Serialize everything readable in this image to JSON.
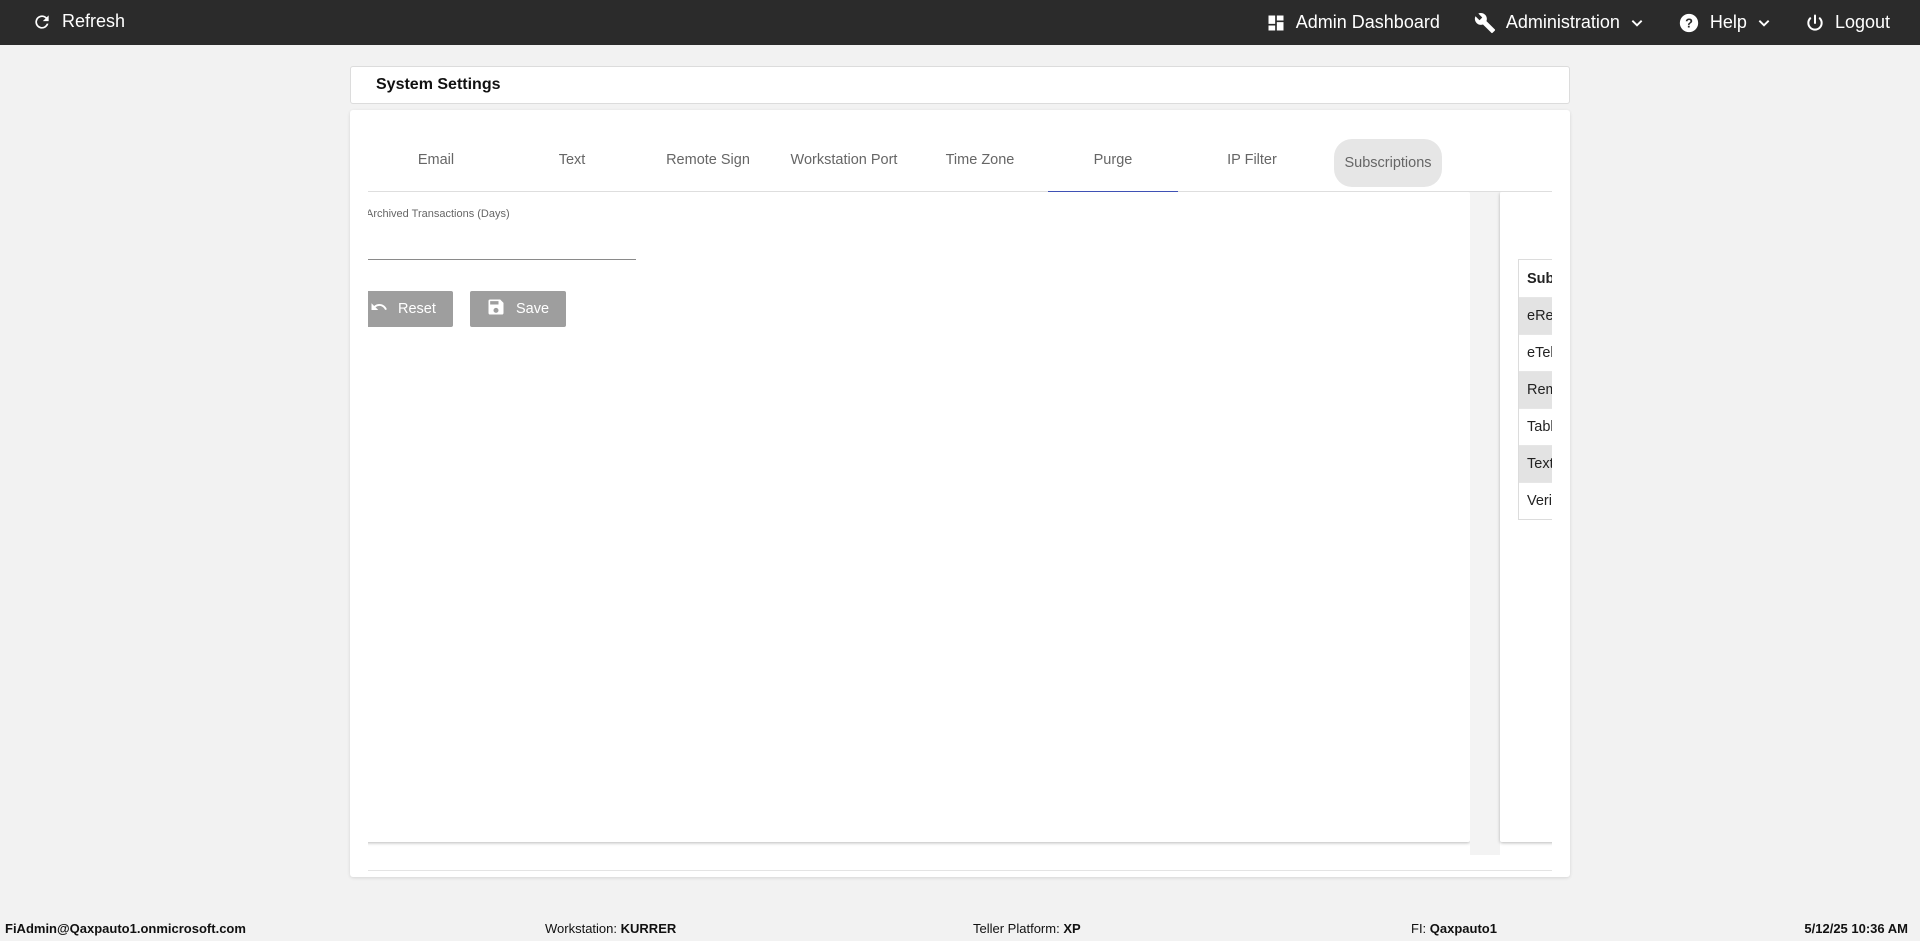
{
  "topbar": {
    "refresh_label": "Refresh",
    "admin_dashboard_label": "Admin Dashboard",
    "administration_label": "Administration",
    "help_label": "Help",
    "logout_label": "Logout"
  },
  "page": {
    "title": "System Settings"
  },
  "tabs": [
    {
      "label": "Email"
    },
    {
      "label": "Text"
    },
    {
      "label": "Remote Sign"
    },
    {
      "label": "Workstation Port"
    },
    {
      "label": "Time Zone"
    },
    {
      "label": "Purge"
    },
    {
      "label": "IP Filter"
    },
    {
      "label": "Subscriptions"
    }
  ],
  "active_tab": "Purge",
  "purge_panel": {
    "field_label": "Archived Transactions (Days)",
    "field_value": "",
    "reset_label": "Reset",
    "save_label": "Save"
  },
  "subscriptions_panel": {
    "header": "Sub",
    "rows": [
      "eRe",
      "eTel",
      "Rem",
      "Tabl",
      "Text",
      "Veri"
    ]
  },
  "status": {
    "user": "FiAdmin@Qaxpauto1.onmicrosoft.com",
    "workstation_label": "Workstation:",
    "workstation_value": "KURRER",
    "teller_label": "Teller Platform:",
    "teller_value": "XP",
    "fi_label": "FI:",
    "fi_value": "Qaxpauto1",
    "datetime": "5/12/25 10:36 AM"
  },
  "colors": {
    "topbar": "#2b2b2b",
    "active_tab_underline": "#3f51b5",
    "button_bg": "#9e9e9e"
  }
}
